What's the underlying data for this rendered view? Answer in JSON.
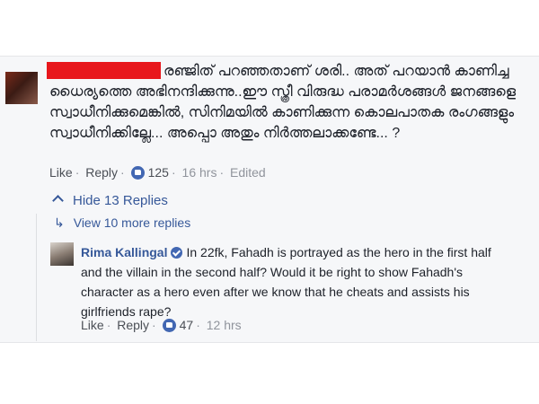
{
  "top_comment": {
    "text": "രഞ്ജിത് പറഞ്ഞതാണ് ശരി.. അത് പറയാൻ കാണിച്ച ധൈര്യത്തെ അഭിനന്ദിക്കുന്നു..ഈ സ്ത്രീ വിരുദ്ധ പരാമർശങ്ങൾ ജനങ്ങളെ സ്വാധീനിക്കുമെങ്കിൽ, സിനിമയിൽ കാണിക്കുന്ന കൊലപാതക രംഗങ്ങളും സ്വാധീനിക്കില്ലേ... അപ്പൊ അതും നിർത്തലാക്കണ്ടേ... ?",
    "like_label": "Like",
    "reply_label": "Reply",
    "like_count": "125",
    "time": "16 hrs",
    "edited": "Edited"
  },
  "replies_toggle": {
    "hide_label": "Hide 13 Replies",
    "view_more_label": "View 10 more replies"
  },
  "reply": {
    "author": "Rima Kallingal",
    "text": "In 22fk, Fahadh is portrayed as the hero in the first half and the villain in the second half? Would it be right to show Fahadh's character as a hero even after we know that he cheats and assists his girlfriends rape?",
    "like_label": "Like",
    "reply_label": "Reply",
    "like_count": "47",
    "time": "12 hrs"
  },
  "colors": {
    "link": "#365899",
    "meta": "#90949c",
    "redaction": "#e8171c",
    "like_badge": "#4267b2"
  },
  "icons": [
    "thumbs-up-icon",
    "verified-badge-icon",
    "chevron-up-icon",
    "reply-arrow-icon"
  ]
}
